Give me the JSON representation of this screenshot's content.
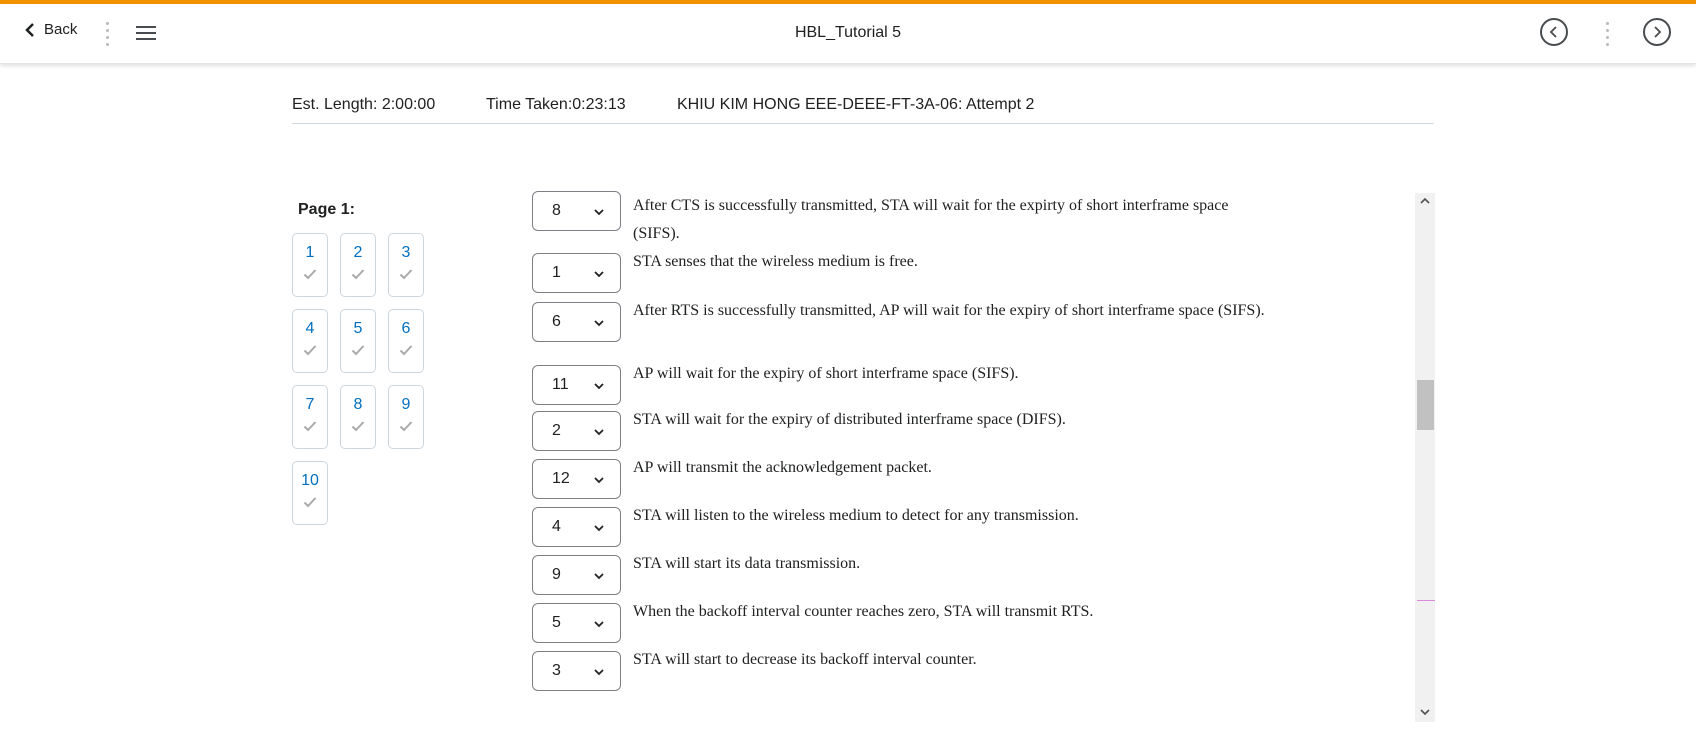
{
  "header": {
    "back_label": "Back",
    "title": "HBL_Tutorial 5",
    "accent_color": "#f39200"
  },
  "info": {
    "est_length": "Est. Length: 2:00:00",
    "time_taken": "Time Taken:0:23:13",
    "attempt": "KHIU KIM HONG EEE-DEEE-FT-3A-06: Attempt 2"
  },
  "nav": {
    "page_label": "Page 1:",
    "questions": [
      "1",
      "2",
      "3",
      "4",
      "5",
      "6",
      "7",
      "8",
      "9",
      "10"
    ]
  },
  "items": [
    {
      "value": "8",
      "text": "After CTS is successfully transmitted, STA will wait for the expirty of short interframe space (SIFS)."
    },
    {
      "value": "1",
      "text": "STA senses that the wireless medium is free."
    },
    {
      "value": "6",
      "text": "After RTS is successfully transmitted, AP will wait for the expiry of short interframe space (SIFS)."
    },
    {
      "value": "11",
      "text": "AP will wait for the expiry of short interframe space (SIFS)."
    },
    {
      "value": "2",
      "text": "STA will wait for the expiry of distributed interframe space (DIFS)."
    },
    {
      "value": "12",
      "text": "AP will transmit the acknowledgement packet."
    },
    {
      "value": "4",
      "text": "STA will listen to the wireless medium to detect for any transmission."
    },
    {
      "value": "9",
      "text": "STA will start its data transmission."
    },
    {
      "value": "5",
      "text": "When the backoff interval counter reaches zero, STA will transmit RTS."
    },
    {
      "value": "3",
      "text": "STA will start to decrease its backoff interval counter."
    }
  ]
}
